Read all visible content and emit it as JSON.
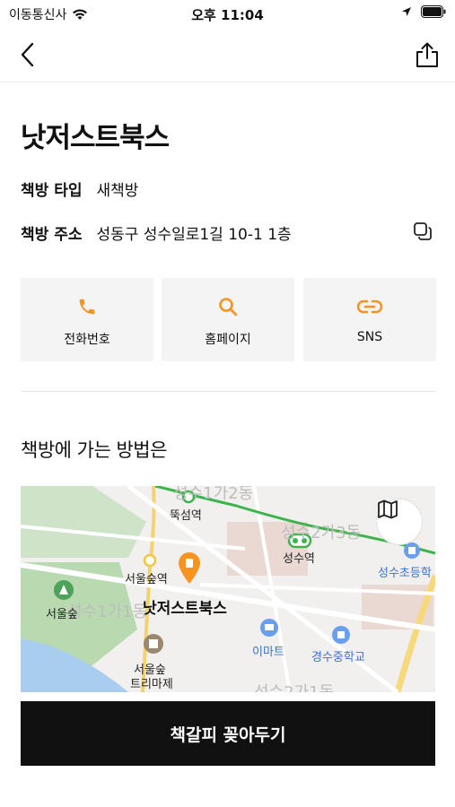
{
  "status_bar": {
    "carrier": "이동통신사",
    "time": "오후 11:04"
  },
  "header": {
    "back_icon": "chevron-left-icon",
    "share_icon": "share-icon"
  },
  "store": {
    "name": "낫저스트북스",
    "type_label": "책방 타입",
    "type_value": "새책방",
    "address_label": "책방 주소",
    "address_value": "성동구 성수일로1길 10-1 1층"
  },
  "actions": [
    {
      "label": "전화번호",
      "icon": "phone-icon"
    },
    {
      "label": "홈페이지",
      "icon": "search-icon"
    },
    {
      "label": "SNS",
      "icon": "link-icon"
    }
  ],
  "directions": {
    "title": "책방에 가는 방법은"
  },
  "map": {
    "labels": {
      "area1": "성수1가2동",
      "area2": "성수2가3동",
      "area3": "성수1가1동",
      "area4": "성수2가1동",
      "station1": "뚝섬역",
      "station2": "성수역",
      "station3": "서울숲역",
      "park": "서울숲",
      "school1": "성수초등학",
      "school2": "경수중학교",
      "store": "낫저스트북스",
      "emart": "이마트",
      "forest_line1": "서울숲",
      "forest_line2": "트리마제"
    },
    "accent": "#f7931e"
  },
  "cta": {
    "label": "책갈피 꽂아두기"
  },
  "colors": {
    "accent": "#f7931e",
    "cta_bg": "#111111",
    "tile_bg": "#f4f4f4"
  }
}
